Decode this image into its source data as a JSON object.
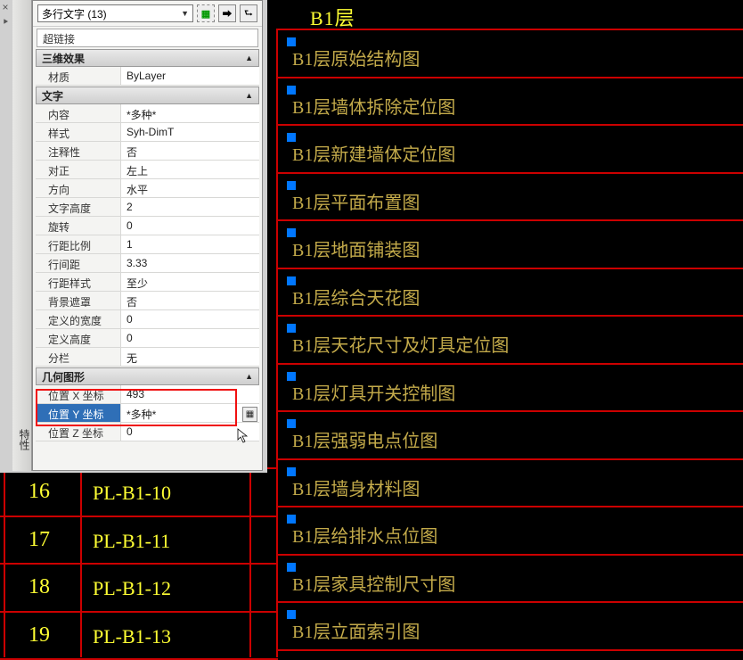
{
  "header_title": "B1层",
  "drawing_rows": [
    {
      "label": "B1层原始结构图"
    },
    {
      "label": "B1层墙体拆除定位图"
    },
    {
      "label": "B1层新建墙体定位图"
    },
    {
      "label": "B1层平面布置图"
    },
    {
      "label": "B1层地面铺装图"
    },
    {
      "label": "B1层综合天花图"
    },
    {
      "label": "B1层天花尺寸及灯具定位图"
    },
    {
      "label": "B1层灯具开关控制图"
    },
    {
      "label": "B1层强弱电点位图"
    },
    {
      "label": "B1层墙身材料图"
    },
    {
      "label": "B1层给排水点位图"
    },
    {
      "label": "B1层家具控制尺寸图"
    },
    {
      "label": "B1层立面索引图"
    }
  ],
  "left_rows": [
    {
      "num": "16",
      "code": "PL-B1-10"
    },
    {
      "num": "17",
      "code": "PL-B1-11"
    },
    {
      "num": "18",
      "code": "PL-B1-12"
    },
    {
      "num": "19",
      "code": "PL-B1-13"
    }
  ],
  "panel": {
    "side_text": "特性",
    "object_selector": "多行文字 (13)",
    "hyperlink_label": "超链接",
    "sections": {
      "effects": {
        "title": "三维效果",
        "rows": [
          {
            "label": "材质",
            "value": "ByLayer"
          }
        ]
      },
      "text": {
        "title": "文字",
        "rows": [
          {
            "label": "内容",
            "value": "*多种*"
          },
          {
            "label": "样式",
            "value": "Syh-DimT"
          },
          {
            "label": "注释性",
            "value": "否"
          },
          {
            "label": "对正",
            "value": "左上"
          },
          {
            "label": "方向",
            "value": "水平"
          },
          {
            "label": "文字高度",
            "value": "2"
          },
          {
            "label": "旋转",
            "value": "0"
          },
          {
            "label": "行距比例",
            "value": "1"
          },
          {
            "label": "行间距",
            "value": "3.33"
          },
          {
            "label": "行距样式",
            "value": "至少"
          },
          {
            "label": "背景遮罩",
            "value": "否"
          },
          {
            "label": "定义的宽度",
            "value": "0"
          },
          {
            "label": "定义高度",
            "value": "0"
          },
          {
            "label": "分栏",
            "value": "无"
          }
        ]
      },
      "geom": {
        "title": "几何图形",
        "rows": [
          {
            "label": "位置 X 坐标",
            "value": "493"
          },
          {
            "label": "位置 Y 坐标",
            "value": "*多种*",
            "selected": true,
            "calc": true
          },
          {
            "label": "位置 Z 坐标",
            "value": "0"
          }
        ]
      }
    }
  }
}
